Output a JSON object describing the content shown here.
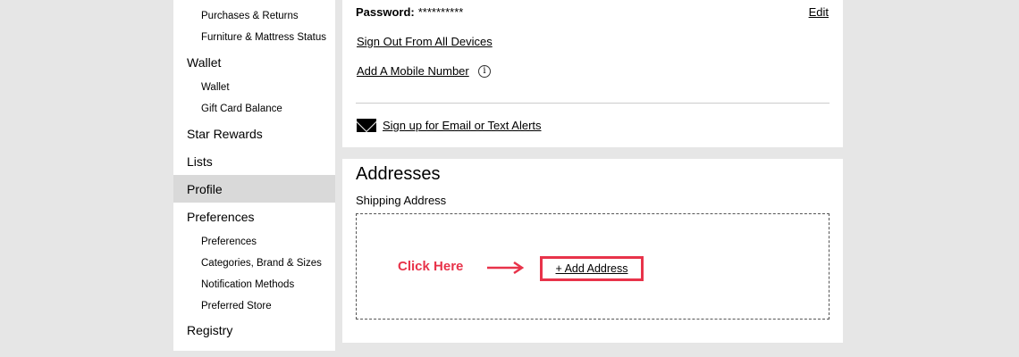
{
  "sidebar": {
    "purchases_returns": "Purchases & Returns",
    "furniture_status": "Furniture & Mattress Status",
    "wallet": "Wallet",
    "wallet_sub": "Wallet",
    "gift_card": "Gift Card Balance",
    "star_rewards": "Star Rewards",
    "lists": "Lists",
    "profile": "Profile",
    "preferences": "Preferences",
    "preferences_sub": "Preferences",
    "categories": "Categories, Brand & Sizes",
    "notification": "Notification Methods",
    "preferred_store": "Preferred Store",
    "registry": "Registry"
  },
  "account": {
    "password_label": "Password:",
    "password_value": "**********",
    "edit": "Edit",
    "sign_out_all": "Sign Out From All Devices",
    "add_mobile": "Add A Mobile Number",
    "info_icon": "i",
    "alerts": "Sign up for Email or Text Alerts"
  },
  "addresses": {
    "title": "Addresses",
    "shipping_label": "Shipping Address",
    "click_here": "Click Here",
    "add_address": "+ Add Address"
  },
  "colors": {
    "accent": "#e8334a",
    "background": "#e6e6e6",
    "active_item": "#d9d9d9"
  }
}
